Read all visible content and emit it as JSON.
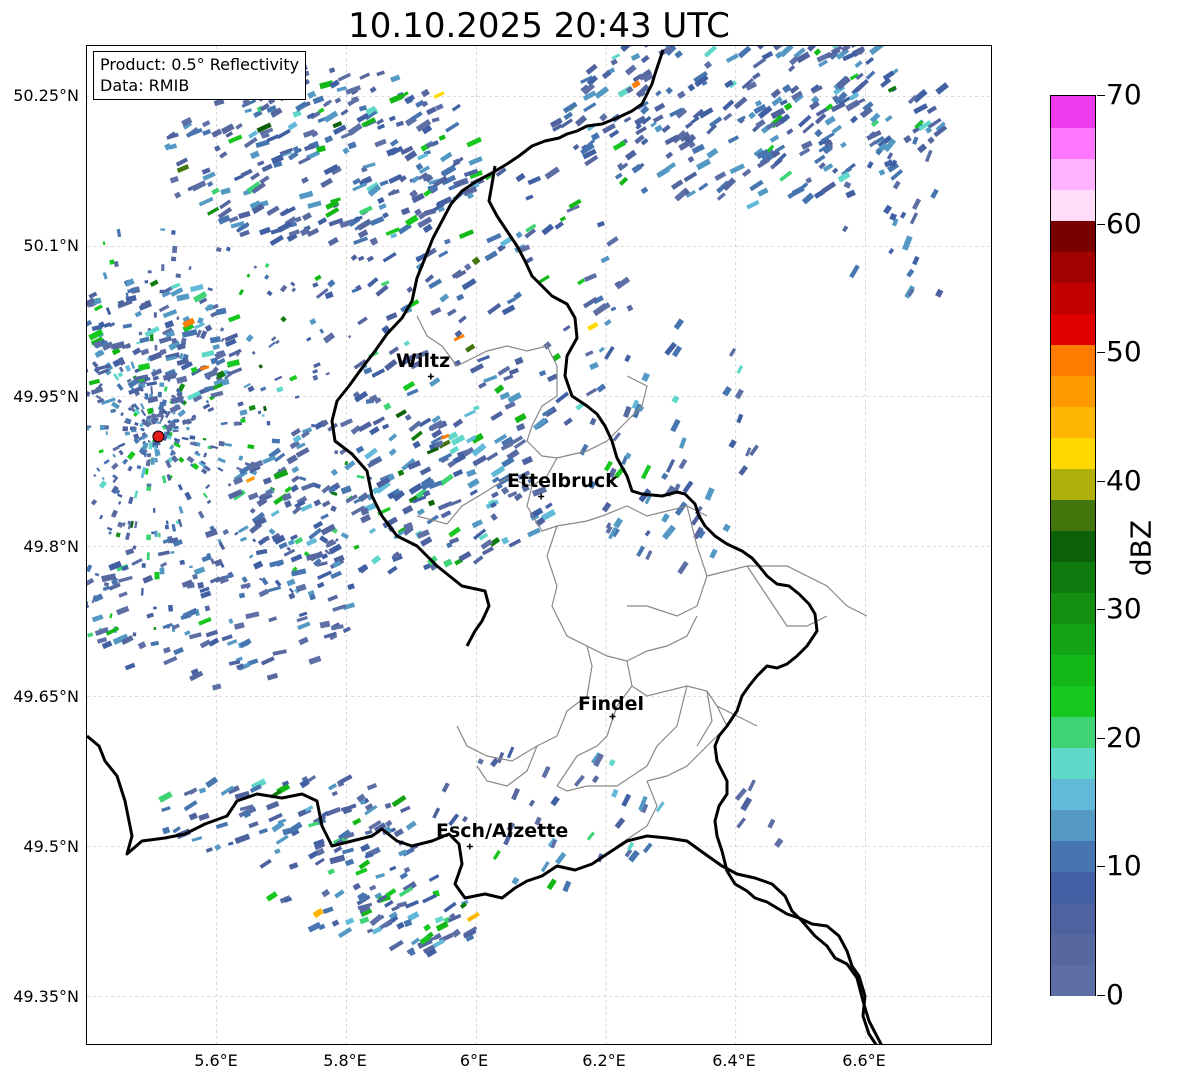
{
  "title": "10.10.2025 20:43 UTC",
  "info_box": {
    "product": "Product: 0.5° Reflectivity",
    "data": "Data: RMIB"
  },
  "lat_labels": [
    "50.25°N",
    "50.1°N",
    "49.95°N",
    "49.8°N",
    "49.65°N",
    "49.5°N",
    "49.35°N"
  ],
  "lon_labels": [
    "5.6°E",
    "5.8°E",
    "6°E",
    "6.2°E",
    "6.4°E",
    "6.6°E"
  ],
  "cities": [
    {
      "name": "Wiltz",
      "lon": 5.93,
      "lat": 49.97
    },
    {
      "name": "Ettelbruck",
      "lon": 6.1,
      "lat": 49.85
    },
    {
      "name": "Findel",
      "lon": 6.21,
      "lat": 49.63
    },
    {
      "name": "Esch/Alzette",
      "lon": 5.99,
      "lat": 49.5
    }
  ],
  "radar_site": {
    "lon": 5.51,
    "lat": 49.91
  },
  "colorbar": {
    "unit": "dBZ",
    "tick_labels": [
      "0",
      "10",
      "20",
      "30",
      "40",
      "50",
      "60",
      "70"
    ],
    "colors": [
      "#5e6fa6",
      "#56689f",
      "#4e62a0",
      "#4160a4",
      "#4675b0",
      "#5499c4",
      "#61bad8",
      "#5fd7c9",
      "#3ed473",
      "#16c81f",
      "#13b817",
      "#12a414",
      "#138f12",
      "#0f7a0e",
      "#0b6009",
      "#42750c",
      "#afb00a",
      "#ffd800",
      "#ffb600",
      "#ff9a00",
      "#ff7c00",
      "#e10000",
      "#c20000",
      "#a30000",
      "#7a0000",
      "#ffddf9",
      "#ffb2ff",
      "#ff77ff",
      "#ec3aec"
    ]
  },
  "map_style": {
    "border_color": "#000000",
    "district_color": "#888888",
    "grid_color": "#bbbbbb",
    "site_marker_color": "#e31a1c"
  }
}
